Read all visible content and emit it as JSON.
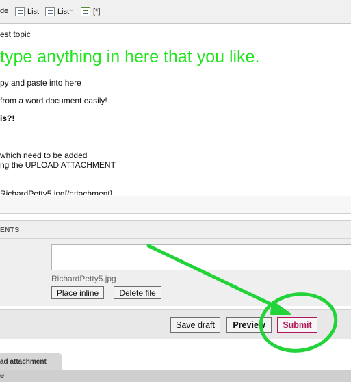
{
  "toolbar": {
    "items": [
      {
        "label": "de"
      },
      {
        "label": "List"
      },
      {
        "label": "List="
      },
      {
        "label": "[*]"
      }
    ]
  },
  "editor": {
    "lines": [
      "est topic",
      "type anything in here that you like.",
      "py and paste into here",
      "from a word document easily!",
      "is?!",
      "which need to be added",
      "ng the UPLOAD ATTACHMENT",
      "RichardPetty5.jpg[/attachment]"
    ]
  },
  "attachments": {
    "header": "ENTS",
    "filename": "RichardPetty5.jpg",
    "place_inline_label": "Place inline",
    "delete_file_label": "Delete file"
  },
  "actions": {
    "save_draft_label": "Save draft",
    "preview_label": "Preview",
    "submit_label": "Submit"
  },
  "tabs": {
    "upload_label": "ad attachment",
    "bottom_label": "e"
  },
  "colors": {
    "annotation": "#22d33a",
    "submit_text": "#b0185a",
    "editor_highlight": "#22e51f"
  }
}
